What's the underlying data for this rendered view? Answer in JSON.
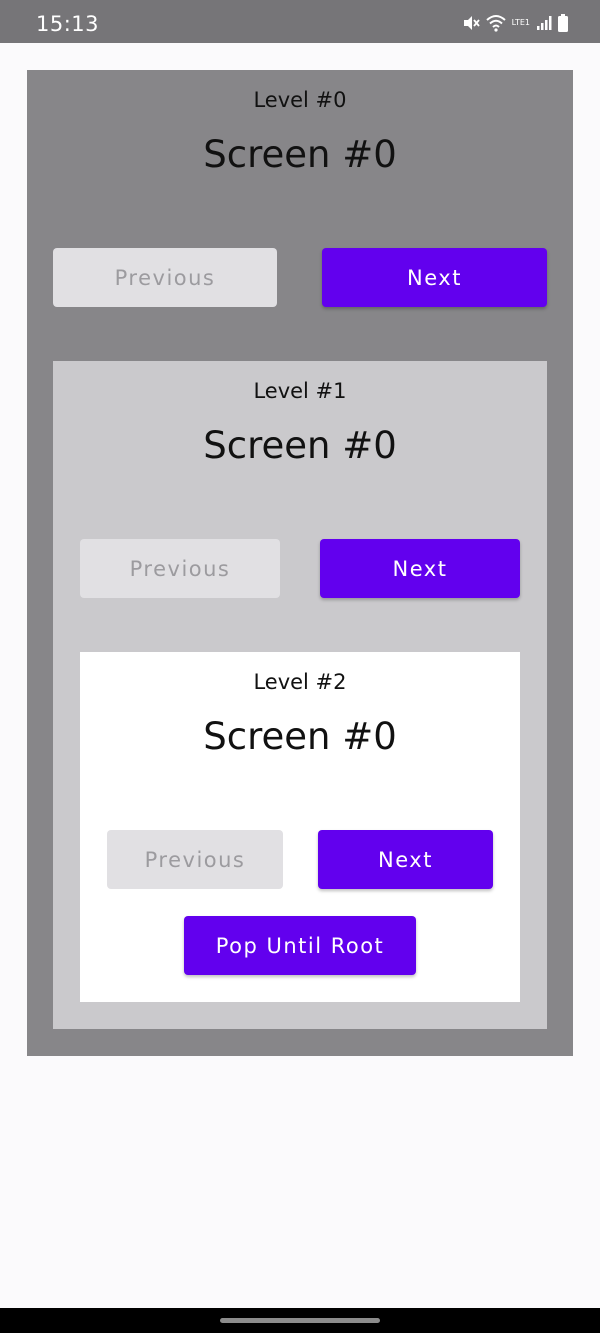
{
  "status_bar": {
    "time": "15:13",
    "network_label": "LTE1",
    "icons": [
      "mute-icon",
      "wifi-icon",
      "signal-icon",
      "battery-icon"
    ]
  },
  "levels": [
    {
      "level_label": "Level #0",
      "screen_title": "Screen #0",
      "previous_label": "Previous",
      "next_label": "Next",
      "background": "#878689"
    },
    {
      "level_label": "Level #1",
      "screen_title": "Screen #0",
      "previous_label": "Previous",
      "next_label": "Next",
      "background": "#cac9cc"
    },
    {
      "level_label": "Level #2",
      "screen_title": "Screen #0",
      "previous_label": "Previous",
      "next_label": "Next",
      "pop_until_root_label": "Pop Until Root",
      "background": "#ffffff"
    }
  ],
  "colors": {
    "accent": "#6200ee",
    "disabled_button": "#e1e0e3",
    "disabled_text": "#9c9b9f"
  }
}
